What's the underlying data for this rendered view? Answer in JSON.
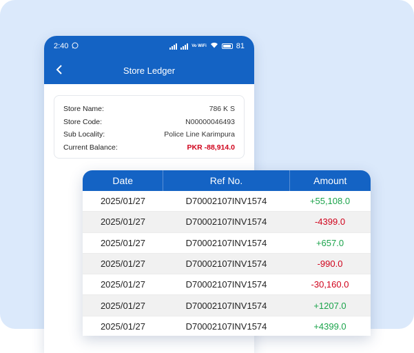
{
  "status_bar": {
    "time": "2:40",
    "network": "Vo WiFi",
    "battery": "81"
  },
  "header": {
    "title": "Store Ledger"
  },
  "store": [
    {
      "label": "Store Name:",
      "value": "786 K S"
    },
    {
      "label": "Store Code:",
      "value": "N00000046493"
    },
    {
      "label": "Sub Locality:",
      "value": "Police Line Karimpura"
    },
    {
      "label": "Current Balance:",
      "value": "PKR -88,914.0"
    }
  ],
  "table": {
    "headers": [
      "Date",
      "Ref No.",
      "Amount"
    ],
    "rows": [
      {
        "date": "2025/01/27",
        "ref": "D70002107INV1574",
        "amount": "+55,108.0"
      },
      {
        "date": "2025/01/27",
        "ref": "D70002107INV1574",
        "amount": "-4399.0"
      },
      {
        "date": "2025/01/27",
        "ref": "D70002107INV1574",
        "amount": "+657.0"
      },
      {
        "date": "2025/01/27",
        "ref": "D70002107INV1574",
        "amount": "-990.0"
      },
      {
        "date": "2025/01/27",
        "ref": "D70002107INV1574",
        "amount": "-30,160.0"
      },
      {
        "date": "2025/01/27",
        "ref": "D70002107INV1574",
        "amount": "+1207.0"
      },
      {
        "date": "2025/01/27",
        "ref": "D70002107INV1574",
        "amount": "+4399.0"
      }
    ]
  },
  "colors": {
    "primary": "#1463c4",
    "positive": "#1aa34a",
    "negative": "#d0021b",
    "background": "#dbe9fb"
  }
}
